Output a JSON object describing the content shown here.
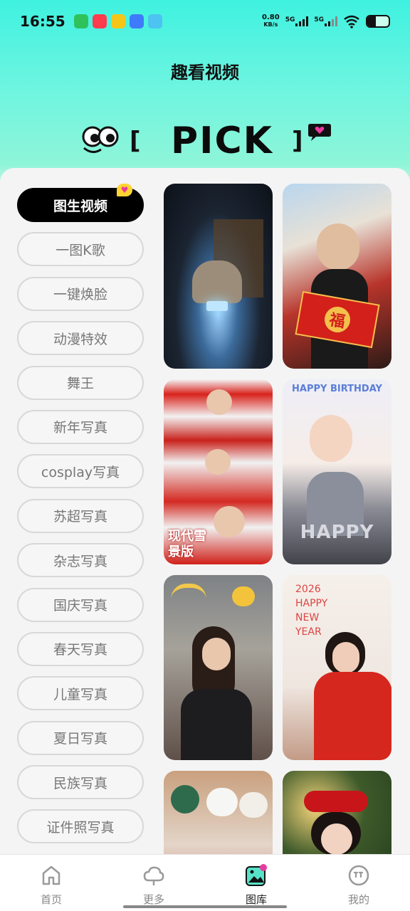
{
  "status_bar": {
    "time": "16:55",
    "net_speed_value": "0.80",
    "net_speed_unit": "KB/s",
    "signal1": "5G",
    "signal2": "5G",
    "battery_level": 0.4
  },
  "header": {
    "title": "趣看视频",
    "banner_text": "PICK"
  },
  "categories": [
    {
      "label": "图生视频",
      "active": true
    },
    {
      "label": "一图K歌"
    },
    {
      "label": "一键焕脸"
    },
    {
      "label": "动漫特效"
    },
    {
      "label": "舞王"
    },
    {
      "label": "新年写真"
    },
    {
      "label": "cosplay写真"
    },
    {
      "label": "苏超写真"
    },
    {
      "label": "杂志写真"
    },
    {
      "label": "国庆写真"
    },
    {
      "label": "春天写真"
    },
    {
      "label": "儿童写真"
    },
    {
      "label": "夏日写真"
    },
    {
      "label": "民族写真"
    },
    {
      "label": "证件照写真"
    }
  ],
  "thumbnails": [
    {
      "caption": ""
    },
    {
      "caption": "福"
    },
    {
      "caption": "现代雪景版"
    },
    {
      "caption": "HAPPY BIRTHDAY"
    },
    {
      "caption": ""
    },
    {
      "caption": "2026 HAPPY NEW YEAR"
    },
    {
      "caption": ""
    },
    {
      "caption": ""
    }
  ],
  "bottom_nav": [
    {
      "label": "首页",
      "icon": "home-icon"
    },
    {
      "label": "更多",
      "icon": "cloud-icon"
    },
    {
      "label": "图库",
      "icon": "gallery-icon",
      "active": true
    },
    {
      "label": "我的",
      "icon": "profile-icon"
    }
  ],
  "colors": {
    "accent": "#3ff1e0",
    "active_tab_bg": "#000000",
    "badge": "#ffd431"
  }
}
